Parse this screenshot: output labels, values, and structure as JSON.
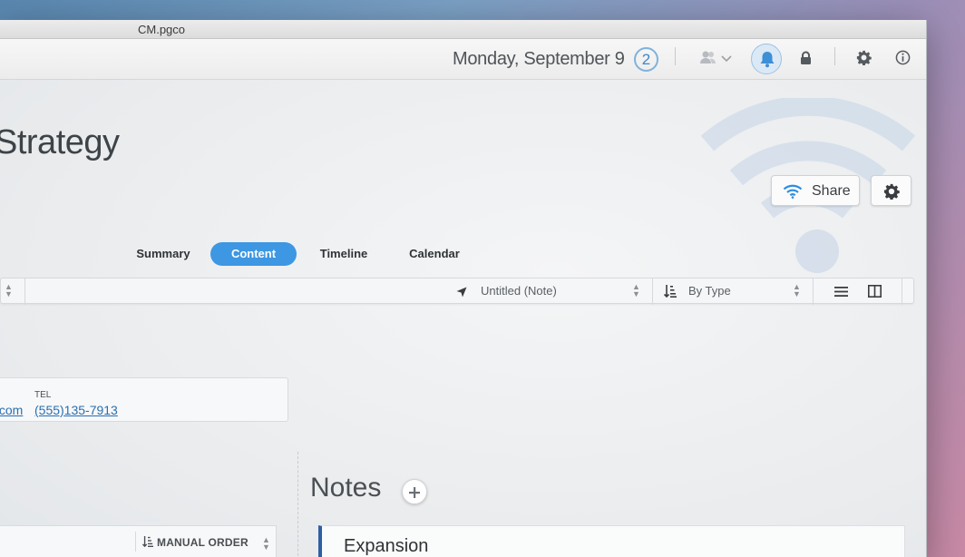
{
  "window": {
    "title": "CM.pgco"
  },
  "topbar": {
    "date": "Monday, September 9",
    "badge_count": "2",
    "icons": [
      "users-icon",
      "chevron-down-icon",
      "bell-icon",
      "lock-icon",
      "gear-icon",
      "info-icon"
    ]
  },
  "page": {
    "title": "Strategy",
    "share_label": "Share"
  },
  "tabs": [
    {
      "label": "Summary"
    },
    {
      "label": "Content"
    },
    {
      "label": "Timeline"
    },
    {
      "label": "Calendar"
    }
  ],
  "toolbar": {
    "location_value": "Untitled (Note)",
    "sort_value": "By Type"
  },
  "contact": {
    "email_fragment": ".com",
    "tel_label": "TEL",
    "tel_value": "(555)135-7913"
  },
  "notes": {
    "title": "Notes",
    "first_note_title": "Expansion"
  },
  "list": {
    "order_label": "MANUAL ORDER"
  },
  "colors": {
    "accent": "#3d97e3",
    "link": "#2a6fb0",
    "note_accent": "#2e5fa6"
  }
}
